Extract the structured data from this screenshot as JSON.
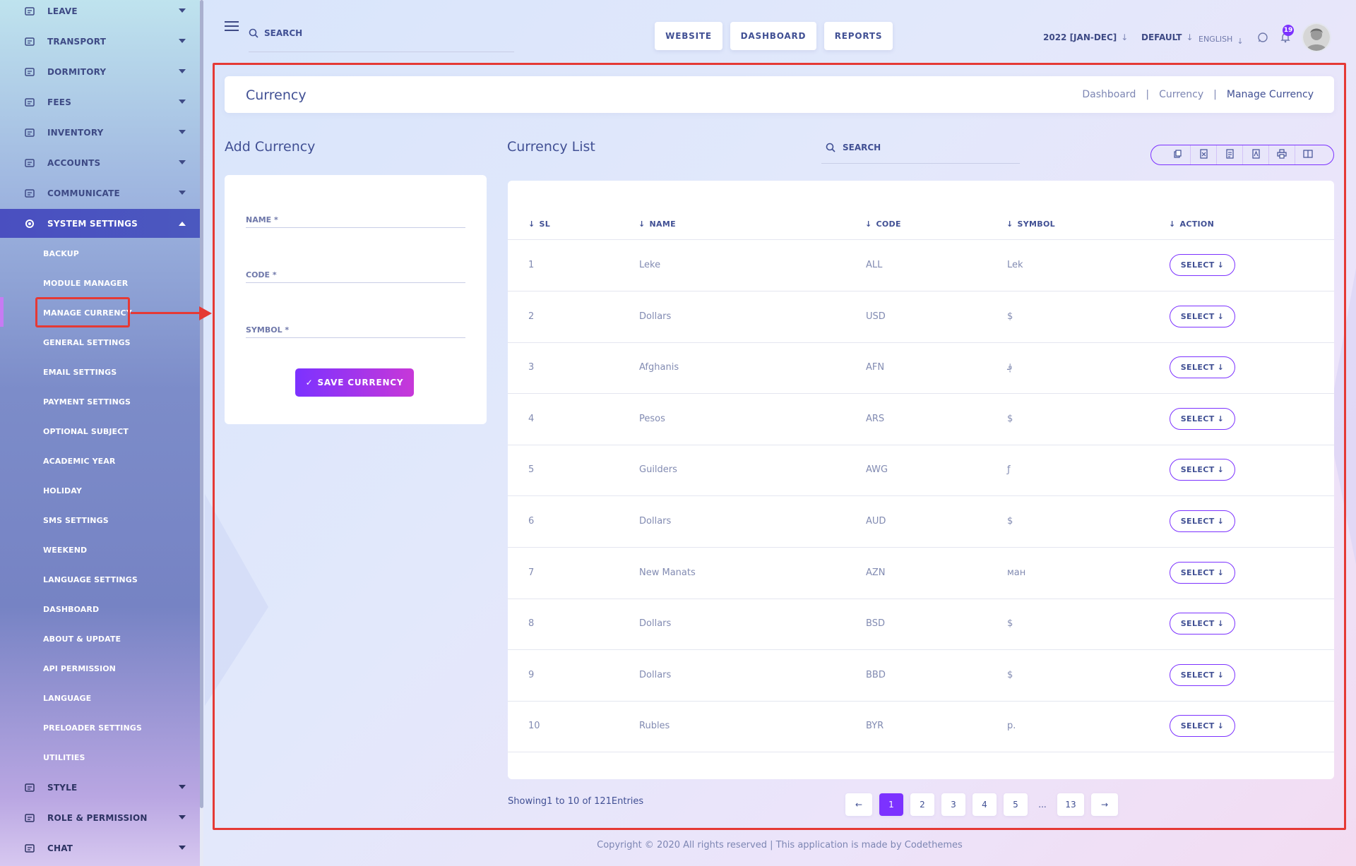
{
  "sidebar": {
    "nav_top": [
      {
        "label": "LEAVE",
        "icon": "leave-icon"
      },
      {
        "label": "TRANSPORT",
        "icon": "bus-icon"
      },
      {
        "label": "DORMITORY",
        "icon": "building-icon"
      },
      {
        "label": "FEES",
        "icon": "receipt-icon"
      },
      {
        "label": "INVENTORY",
        "icon": "inventory-icon"
      },
      {
        "label": "ACCOUNTS",
        "icon": "calculator-icon"
      },
      {
        "label": "COMMUNICATE",
        "icon": "chat-bubble-icon"
      }
    ],
    "active": {
      "label": "SYSTEM SETTINGS",
      "icon": "gear-icon"
    },
    "sub_items": [
      "BACKUP",
      "MODULE MANAGER",
      "MANAGE CURRENCY",
      "GENERAL SETTINGS",
      "EMAIL SETTINGS",
      "PAYMENT SETTINGS",
      "OPTIONAL SUBJECT",
      "ACADEMIC YEAR",
      "HOLIDAY",
      "SMS SETTINGS",
      "WEEKEND",
      "LANGUAGE SETTINGS",
      "DASHBOARD",
      "ABOUT & UPDATE",
      "API PERMISSION",
      "LANGUAGE",
      "PRELOADER SETTINGS",
      "UTILITIES"
    ],
    "nav_bottom": [
      {
        "label": "STYLE",
        "icon": "paint-icon"
      },
      {
        "label": "ROLE & PERMISSION",
        "icon": "role-icon"
      },
      {
        "label": "CHAT",
        "icon": "chat-icon"
      }
    ]
  },
  "topbar": {
    "search_placeholder": "SEARCH",
    "buttons": [
      "WEBSITE",
      "DASHBOARD",
      "REPORTS"
    ],
    "academic_year": "2022 [JAN-DEC]",
    "theme": "DEFAULT",
    "language": "ENGLISH",
    "notification_count": "19"
  },
  "page": {
    "title": "Currency",
    "breadcrumbs": [
      "Dashboard",
      "Currency",
      "Manage Currency"
    ],
    "breadcrumb_sep": "|"
  },
  "form": {
    "title": "Add Currency",
    "name_placeholder": "NAME *",
    "code_placeholder": "CODE *",
    "symbol_placeholder": "SYMBOL *",
    "save_label": "SAVE CURRENCY"
  },
  "list": {
    "title": "Currency List",
    "search_placeholder": "SEARCH",
    "export_icons": [
      "copy-icon",
      "excel-icon",
      "csv-icon",
      "pdf-icon",
      "print-icon",
      "columns-icon"
    ],
    "columns": [
      "SL",
      "NAME",
      "CODE",
      "SYMBOL",
      "ACTION"
    ],
    "rows": [
      {
        "sl": "1",
        "name": "Leke",
        "code": "ALL",
        "symbol": "Lek"
      },
      {
        "sl": "2",
        "name": "Dollars",
        "code": "USD",
        "symbol": "$"
      },
      {
        "sl": "3",
        "name": "Afghanis",
        "code": "AFN",
        "symbol": "؋"
      },
      {
        "sl": "4",
        "name": "Pesos",
        "code": "ARS",
        "symbol": "$"
      },
      {
        "sl": "5",
        "name": "Guilders",
        "code": "AWG",
        "symbol": "ƒ"
      },
      {
        "sl": "6",
        "name": "Dollars",
        "code": "AUD",
        "symbol": "$"
      },
      {
        "sl": "7",
        "name": "New Manats",
        "code": "AZN",
        "symbol": "ман"
      },
      {
        "sl": "8",
        "name": "Dollars",
        "code": "BSD",
        "symbol": "$"
      },
      {
        "sl": "9",
        "name": "Dollars",
        "code": "BBD",
        "symbol": "$"
      },
      {
        "sl": "10",
        "name": "Rubles",
        "code": "BYR",
        "symbol": "p."
      }
    ],
    "action_label": "SELECT",
    "showing": "Showing1 to 10 of 121Entries",
    "pages": [
      "1",
      "2",
      "3",
      "4",
      "5",
      "...",
      "13"
    ],
    "current_page": "1"
  },
  "footer": "Copyright © 2020 All rights reserved | This application is made by Codethemes"
}
